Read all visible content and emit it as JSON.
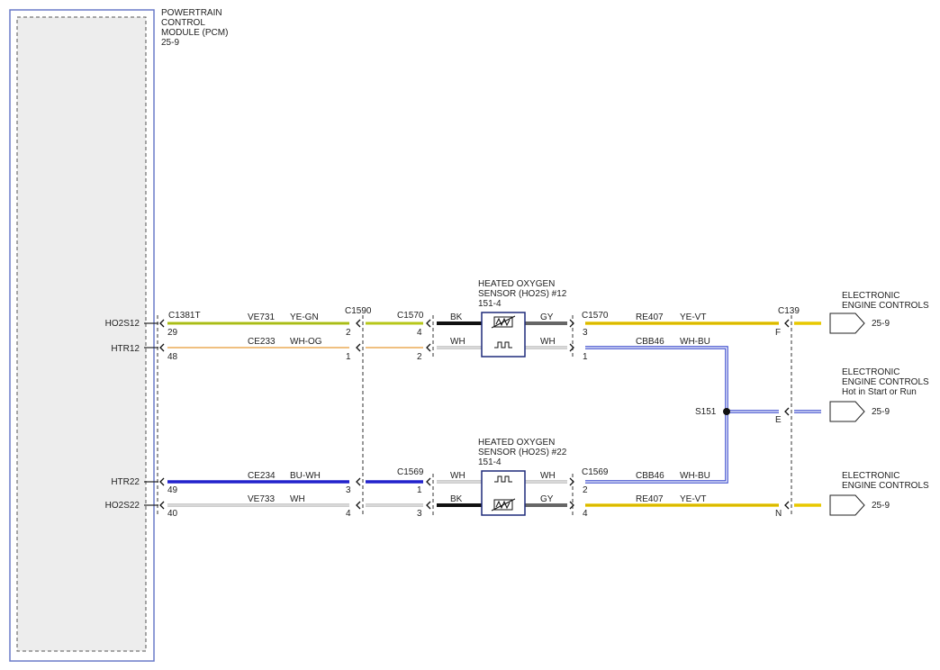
{
  "pcm": {
    "title_lines": [
      "POWERTRAIN",
      "CONTROL",
      "MODULE (PCM)",
      "25-9"
    ]
  },
  "pins": [
    {
      "label": "HO2S12",
      "pin": "29"
    },
    {
      "label": "HTR12",
      "pin": "48"
    },
    {
      "label": "HTR22",
      "pin": "49"
    },
    {
      "label": "HO2S22",
      "pin": "40"
    }
  ],
  "connectors": {
    "pcm": "C1381T",
    "upper_inline": "C1590",
    "lower_inline": "C1569",
    "upper_sensor_left": "C1570",
    "upper_sensor_right": "C1570",
    "lower_sensor_right": "C1569",
    "right": "C139"
  },
  "wires": [
    {
      "circuit": "VE731",
      "color": "YE-GN",
      "pin_inline": "2",
      "pin_sensor": "4",
      "sensor_color": "BK",
      "hex": "#b7c71a"
    },
    {
      "circuit": "CE233",
      "color": "WH-OG",
      "pin_inline": "1",
      "pin_sensor": "2",
      "sensor_color": "WH",
      "hex": "#f0c080"
    },
    {
      "circuit": "CE234",
      "color": "BU-WH",
      "pin_inline": "3",
      "pin_sensor": "1",
      "sensor_color": "WH",
      "hex": "#2222cc"
    },
    {
      "circuit": "VE733",
      "color": "WH",
      "pin_inline": "4",
      "pin_sensor": "3",
      "sensor_color": "BK",
      "hex": "#999999"
    }
  ],
  "sensors": [
    {
      "title_lines": [
        "HEATED OXYGEN",
        "SENSOR (HO2S) #12",
        "151-4"
      ],
      "right_top": "GY",
      "right_bottom": "WH"
    },
    {
      "title_lines": [
        "HEATED OXYGEN",
        "SENSOR (HO2S) #22",
        "151-4"
      ],
      "right_top": "WH",
      "right_bottom": "GY"
    }
  ],
  "right_wires": [
    {
      "circuit": "RE407",
      "color": "YE-VT",
      "pin_left": "3",
      "pin_right": "F",
      "hex": "#e8c800"
    },
    {
      "circuit": "CBB46",
      "color": "WH-BU",
      "pin_left": "1",
      "pin_right": "",
      "hex": "#3344cc"
    },
    {
      "circuit": "CBB46",
      "color": "WH-BU",
      "pin_left": "2",
      "pin_right": "",
      "hex": "#3344cc"
    },
    {
      "circuit": "RE407",
      "color": "YE-VT",
      "pin_left": "4",
      "pin_right": "N",
      "hex": "#e8c800"
    }
  ],
  "splice": {
    "label": "S151",
    "pin_right": "E"
  },
  "destinations": [
    {
      "lines": [
        "ELECTRONIC",
        "ENGINE CONTROLS"
      ],
      "ref": "25-9"
    },
    {
      "lines": [
        "ELECTRONIC",
        "ENGINE CONTROLS",
        "Hot in Start or Run"
      ],
      "ref": "25-9"
    },
    {
      "lines": [
        "ELECTRONIC",
        "ENGINE CONTROLS"
      ],
      "ref": "25-9"
    }
  ]
}
